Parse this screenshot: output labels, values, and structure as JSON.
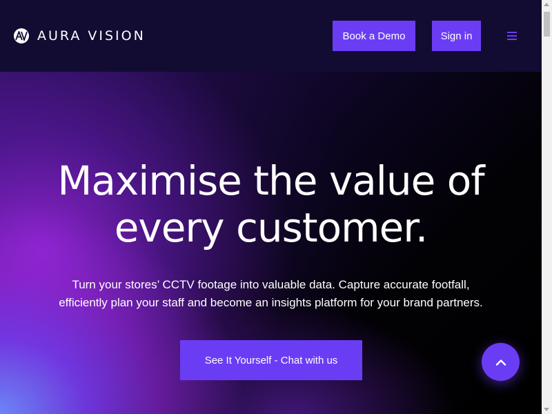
{
  "header": {
    "brand": "AURA VISION",
    "logo_icon": "av-logo-icon",
    "book_demo_label": "Book a Demo",
    "sign_in_label": "Sign in",
    "menu_icon": "hamburger-menu-icon"
  },
  "hero": {
    "title_line1": "Maximise the value of",
    "title_line2": "every customer.",
    "subtitle_line1": "Turn your stores’ CCTV footage into valuable data. Capture accurate footfall,",
    "subtitle_line2": "efficiently plan your staff and become an insights platform for your brand partners.",
    "cta_label": "See It Yourself - Chat with us"
  },
  "scroll_top_icon": "chevron-up-icon",
  "colors": {
    "header_bg": "#120c33",
    "accent": "#6a3df5",
    "text": "#ffffff"
  }
}
